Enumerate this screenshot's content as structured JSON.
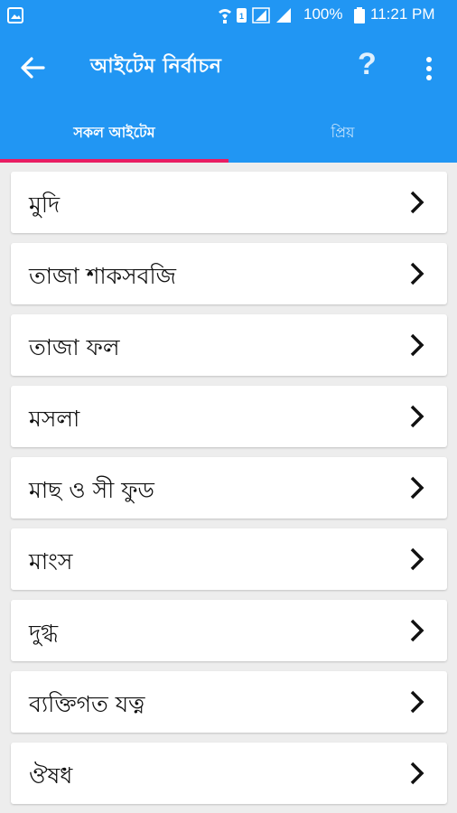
{
  "status_bar": {
    "battery_percent": "100%",
    "time": "11:21 PM",
    "icons": [
      "gallery-icon",
      "wifi-calling-icon",
      "sim-icon",
      "sim-signal-icon",
      "signal-icon",
      "battery-icon"
    ]
  },
  "app_bar": {
    "title": "আইটেম নির্বাচন",
    "help_label": "?",
    "icons": [
      "back-arrow-icon",
      "help-icon",
      "more-vert-icon"
    ]
  },
  "tabs": [
    {
      "label": "সকল আইটেম",
      "selected": true
    },
    {
      "label": "প্রিয়",
      "selected": false
    }
  ],
  "categories": [
    {
      "label": "মুদি"
    },
    {
      "label": "তাজা শাকসবজি"
    },
    {
      "label": "তাজা ফল"
    },
    {
      "label": "মসলা"
    },
    {
      "label": "মাছ ও সী ফুড"
    },
    {
      "label": "মাংস"
    },
    {
      "label": "দুগ্ধ"
    },
    {
      "label": "ব্যক্তিগত যত্ন"
    },
    {
      "label": "ঔষধ"
    }
  ],
  "colors": {
    "primary": "#2196f3",
    "tab_indicator": "#e91e63",
    "background": "#ededed"
  }
}
